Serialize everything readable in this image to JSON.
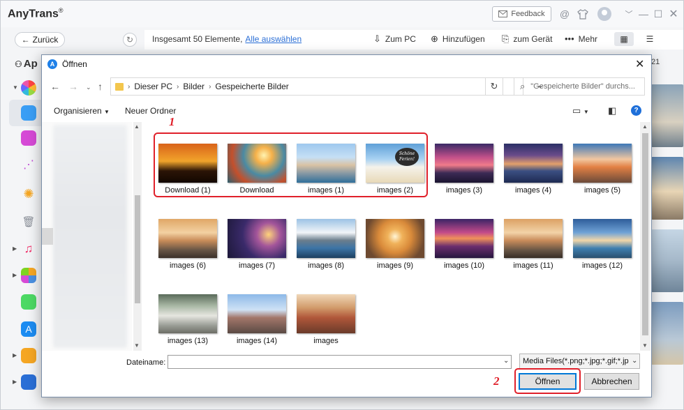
{
  "app": {
    "title": "AnyTrans",
    "feedback_label": "Feedback",
    "back_label": "Zurück",
    "section_label": "Ap",
    "count_text": "Insgesamt 50 Elemente,",
    "select_all": "Alle auswählen",
    "actions": {
      "to_pc": "Zum PC",
      "add": "Hinzufügen",
      "to_device": "zum Gerät",
      "more": "Mehr"
    },
    "page_indicator": "21"
  },
  "dialog": {
    "title": "Öffnen",
    "breadcrumb": [
      "Dieser PC",
      "Bilder",
      "Gespeicherte Bilder"
    ],
    "search_placeholder": "\"Gespeicherte Bilder\" durchs...",
    "commands": {
      "organize": "Organisieren",
      "new_folder": "Neuer Ordner"
    },
    "files": [
      {
        "name": "Download (1)",
        "icon": "sunset-tree"
      },
      {
        "name": "Download",
        "icon": "autumn-leaves"
      },
      {
        "name": "images (1)",
        "icon": "coastal-town"
      },
      {
        "name": "images (2)",
        "icon": "beach-chair"
      },
      {
        "name": "images (3)",
        "icon": "pink-sunset"
      },
      {
        "name": "images (4)",
        "icon": "sea-sunset"
      },
      {
        "name": "images (5)",
        "icon": "pier-sunset"
      },
      {
        "name": "images (6)",
        "icon": "harbor-dusk"
      },
      {
        "name": "images (7)",
        "icon": "flowers-dusk"
      },
      {
        "name": "images (8)",
        "icon": "mountain-lake"
      },
      {
        "name": "images (9)",
        "icon": "phone-beach"
      },
      {
        "name": "images (10)",
        "icon": "purple-sunset"
      },
      {
        "name": "images (11)",
        "icon": "harbor-dusk-2"
      },
      {
        "name": "images (12)",
        "icon": "palm-beach"
      },
      {
        "name": "images (13)",
        "icon": "patio"
      },
      {
        "name": "images (14)",
        "icon": "church"
      },
      {
        "name": "images",
        "icon": "forest-path"
      }
    ],
    "thumb_text": {
      "line1": "Schöne",
      "line2": "Ferien!"
    },
    "filename_label": "Dateiname:",
    "filename_value": "",
    "filetype": "Media Files(*.png;*.jpg;*.gif;*.jp",
    "open_label": "Öffnen",
    "cancel_label": "Abbrechen"
  },
  "annotations": {
    "step1": "1",
    "step2": "2"
  },
  "colors": {
    "highlight": "#e0202a",
    "link": "#2b6fd6",
    "focus": "#0078d7"
  }
}
